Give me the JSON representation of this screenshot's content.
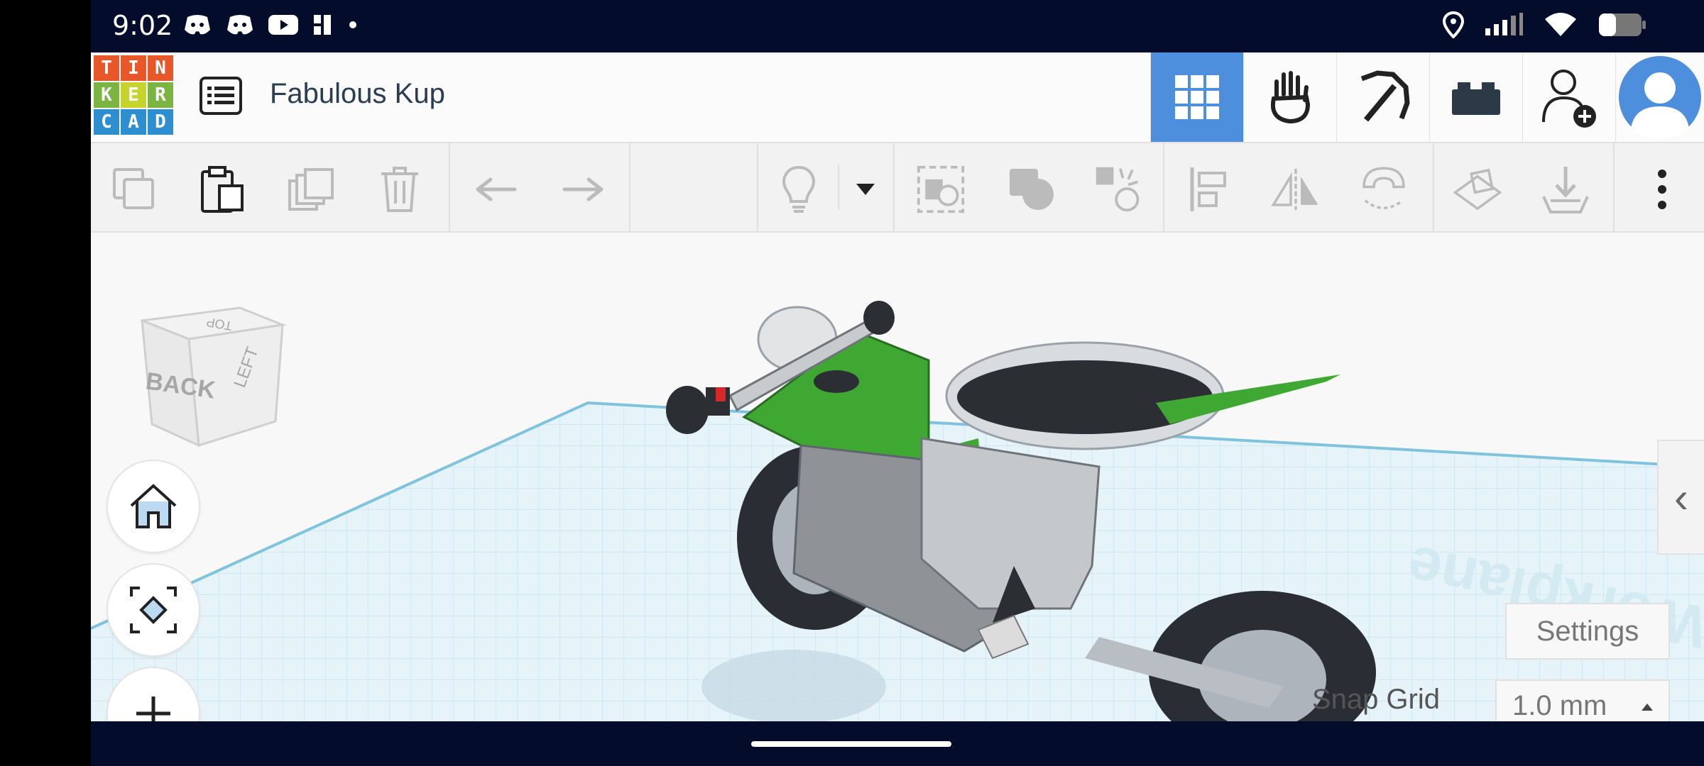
{
  "status_bar": {
    "time": "9:02",
    "left_icons": [
      "discord-icon",
      "discord-icon",
      "youtube-icon",
      "app-icon",
      "dot-icon"
    ],
    "right_icons": [
      "location-icon",
      "signal-icon",
      "wifi-icon",
      "battery-icon"
    ]
  },
  "topbar": {
    "logo_letters": [
      "T",
      "I",
      "N",
      "K",
      "E",
      "R",
      "C",
      "A",
      "D"
    ],
    "logo_colors": [
      "#e8572a",
      "#e8572a",
      "#e8572a",
      "#7ab541",
      "#7ab541",
      "#7ab541",
      "#2d8fd0",
      "#2d8fd0",
      "#2d8fd0"
    ],
    "design_title": "Fabulous Kup",
    "buttons": [
      "3d-grid-icon",
      "blocks-hand-icon",
      "pickaxe-icon",
      "brick-icon",
      "add-user-icon",
      "avatar-icon"
    ]
  },
  "toolbar": {
    "tools": [
      "copy",
      "paste",
      "duplicate",
      "delete",
      "undo",
      "redo",
      "light-bulb",
      "dropdown",
      "group",
      "shape-union",
      "ungroup",
      "align",
      "mirror",
      "magnet",
      "workplane",
      "import"
    ]
  },
  "viewport": {
    "viewcube_faces": {
      "top": "TOP",
      "front": "BACK",
      "side": "LEFT"
    },
    "workplane_label": "Workplane",
    "settings_label": "Settings",
    "snap_grid_label": "Snap Grid",
    "snap_grid_value": "1.0 mm"
  },
  "colors": {
    "accent": "#4d8fdc",
    "bar": "#040c2c",
    "bike_green": "#3fa832"
  }
}
